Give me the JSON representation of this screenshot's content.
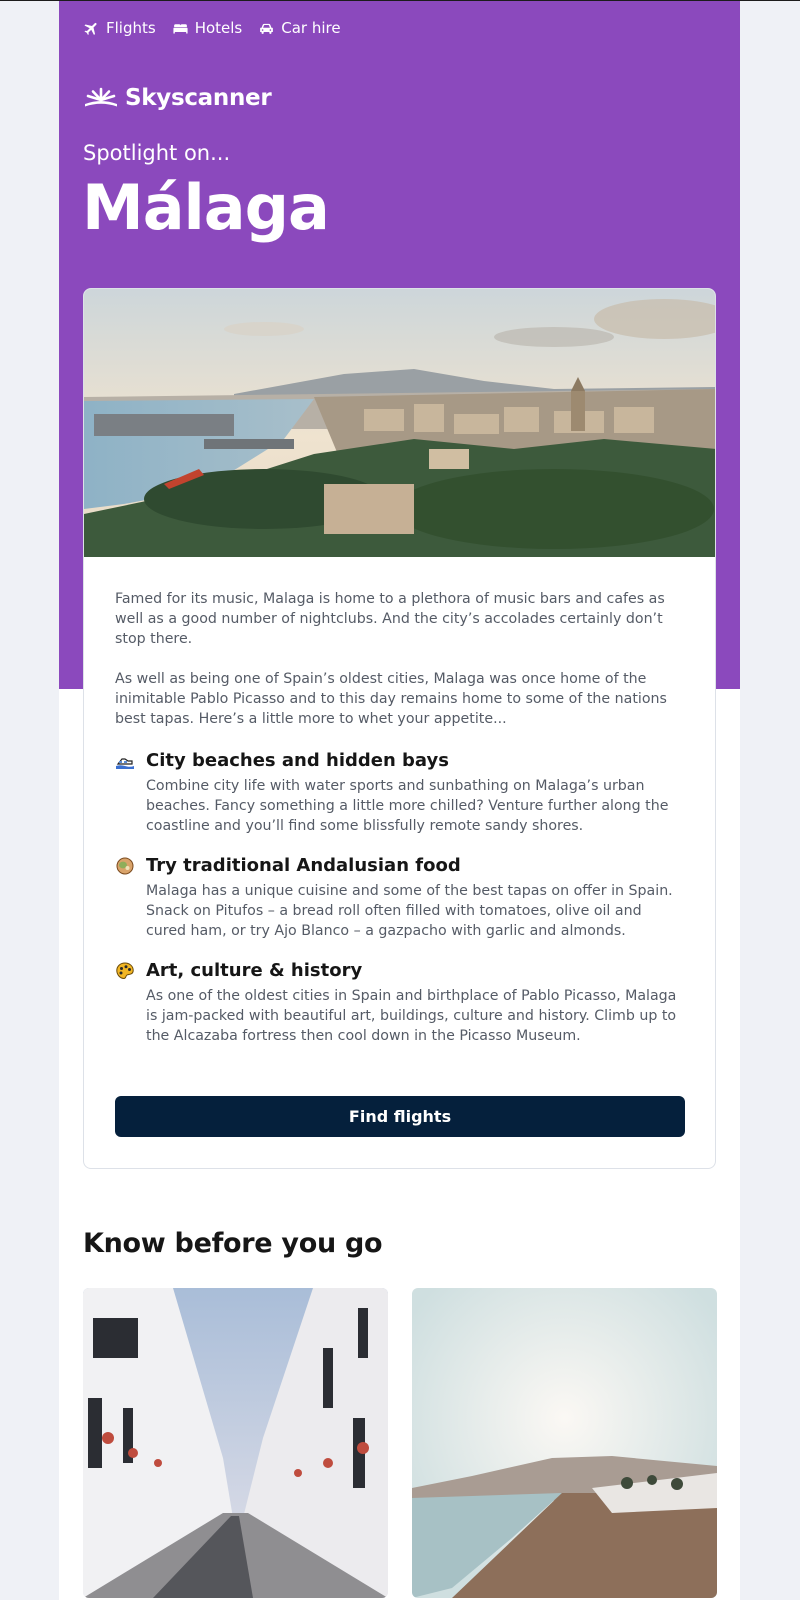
{
  "nav": [
    {
      "label": "Flights",
      "icon": "plane-icon"
    },
    {
      "label": "Hotels",
      "icon": "bed-icon"
    },
    {
      "label": "Car hire",
      "icon": "car-icon"
    }
  ],
  "brand": {
    "name": "Skyscanner",
    "icon": "skyscanner-sunrise-icon"
  },
  "hero": {
    "eyebrow": "Spotlight on...",
    "city": "Málaga"
  },
  "card": {
    "paragraphs": [
      "Famed for its music, Malaga is home to a plethora of music bars and cafes as well as a good number of nightclubs. And the city’s accolades certainly don’t stop there.",
      "As well as being one of Spain’s oldest cities, Malaga was once home of the inimitable Pablo Picasso and to this day remains home to some of the nations best tapas. Here’s a little more to whet your appetite..."
    ],
    "features": [
      {
        "icon": "beach-icon",
        "title": "City beaches and hidden bays",
        "text": "Combine city life with water sports and sunbathing on Malaga’s urban beaches. Fancy something a little more chilled? Venture further along the coastline and you’ll find some blissfully remote sandy shores."
      },
      {
        "icon": "food-bowl-icon",
        "title": "Try traditional Andalusian food",
        "text": "Malaga has a unique cuisine and some of the best tapas on offer in Spain. Snack on Pitufos – a bread roll often filled with tomatoes, olive oil and cured ham, or try Ajo Blanco – a gazpacho with garlic and almonds."
      },
      {
        "icon": "palette-icon",
        "title": "Art, culture & history",
        "text": "As one of the oldest cities in Spain and birthplace of Pablo Picasso, Malaga is jam-packed with beautiful art, buildings, culture and history. Climb up to the Alcazaba fortress then cool down in the Picasso Museum."
      }
    ],
    "cta": "Find flights"
  },
  "section": {
    "title": "Know before you go"
  },
  "colors": {
    "purple": "#8b49bd",
    "navy": "#05203c",
    "text": "#161616",
    "muted": "#555b66"
  }
}
